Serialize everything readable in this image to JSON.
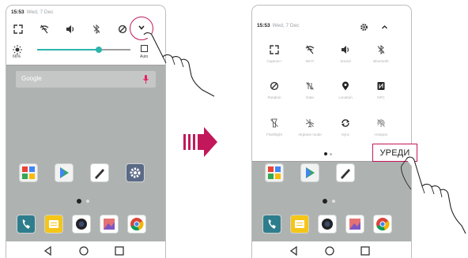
{
  "left_phone": {
    "status": {
      "time": "15:53",
      "date": "Wed, 7 Dec"
    },
    "quick_icons": [
      "capture-icon",
      "wifi-off-icon",
      "sound-icon",
      "bluetooth-off-icon",
      "rotation-lock-icon"
    ],
    "brightness": {
      "percent_label": "66%",
      "level": 0.66,
      "auto_label": "Auto"
    },
    "search": {
      "label": "Google"
    }
  },
  "arrow": {
    "icon": "right-arrow-icon",
    "color": "#c2185b"
  },
  "right_phone": {
    "status": {
      "time": "15:53",
      "date": "Wed, 7 Dec"
    },
    "tiles": [
      {
        "label": "Capture+",
        "icon": "capture-icon"
      },
      {
        "label": "Wi-Fi",
        "icon": "wifi-off-icon"
      },
      {
        "label": "Sound",
        "icon": "sound-icon"
      },
      {
        "label": "Bluetooth",
        "icon": "bluetooth-off-icon"
      },
      {
        "label": "Rotation",
        "icon": "rotation-lock-icon"
      },
      {
        "label": "Data",
        "icon": "data-off-icon"
      },
      {
        "label": "Location",
        "icon": "location-icon"
      },
      {
        "label": "NFC",
        "icon": "nfc-icon"
      },
      {
        "label": "Flashlight",
        "icon": "flashlight-icon"
      },
      {
        "label": "Airplane mode",
        "icon": "airplane-icon"
      },
      {
        "label": "Sync",
        "icon": "sync-icon"
      },
      {
        "label": "Hotspot",
        "icon": "hotspot-icon"
      }
    ],
    "edit_label": "УРЕДИ"
  },
  "colors": {
    "accent": "#c2185b",
    "teal": "#2bb5ac",
    "wallpaper": "#aeb2b1"
  }
}
